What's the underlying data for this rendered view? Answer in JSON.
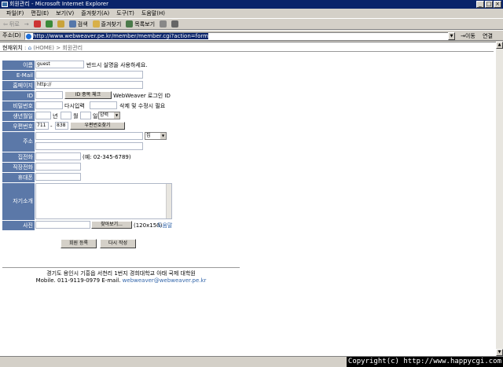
{
  "window": {
    "title": "회원관리 - Microsoft Internet Explorer",
    "min": "_",
    "max": "□",
    "close": "×"
  },
  "menu": [
    "파일(F)",
    "편집(E)",
    "보기(V)",
    "즐겨찾기(A)",
    "도구(T)",
    "도움말(H)"
  ],
  "toolbar": {
    "back": "뒤로",
    "forward": "→",
    "search": "검색",
    "favorites": "즐겨찾기",
    "history": "목록보기"
  },
  "address": {
    "label": "주소(D)",
    "url": "http://www.webweaver.pe.kr/member/member.cgi?action=form",
    "go": "이동",
    "links": "연결"
  },
  "breadcrumb": {
    "current": "현재위치",
    "home": "(HOME)",
    "sep": ">",
    "page": "회원관리"
  },
  "form": {
    "name": {
      "label": "이름",
      "value": "guest",
      "note": "반드시 실명을 사용하세요."
    },
    "email": {
      "label": "E-Mail"
    },
    "homepage": {
      "label": "홈페이지",
      "value": "http://"
    },
    "id": {
      "label": "ID",
      "check_btn": "ID 중복 체크",
      "note": "WebWeaver 로그인 ID"
    },
    "password": {
      "label": "비밀번호",
      "again": "다시입력",
      "note": "삭제 및 수정시 필요"
    },
    "birthday": {
      "label": "생년월일",
      "year": "년",
      "month": "월",
      "day": "일",
      "calendar": "양력"
    },
    "zipcode": {
      "label": "우편번호",
      "zip1": "711",
      "dash": "-",
      "zip2": "838",
      "find_btn": "우편번호찾기"
    },
    "address": {
      "label": "주소",
      "type": "집"
    },
    "home_phone": {
      "label": "집전화",
      "example": "(예: 02-345-6789)"
    },
    "work_phone": {
      "label": "직장전화"
    },
    "mobile": {
      "label": "휴대폰"
    },
    "intro": {
      "label": "자기소개"
    },
    "photo": {
      "label": "사진",
      "browse_btn": "찾아보기...",
      "size": "(120x150)",
      "help": "도움말"
    },
    "submit": "회원 등록",
    "reset": "다시 작성"
  },
  "footer": {
    "line1": "경기도 용인시 기흥읍 서천리 1번지 경희대학교 아태 국제 대학원",
    "line2": "Mobile. 011-9119-0979 E-mail.",
    "email": "webweaver@webweaver.pe.kr"
  },
  "copyright": "Copyright(c) http://www.happycgi.com"
}
